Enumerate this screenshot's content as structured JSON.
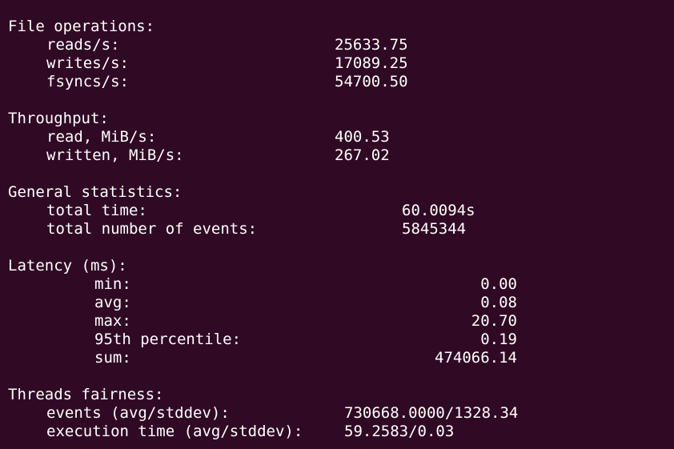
{
  "file_operations": {
    "title": "File operations:",
    "reads_label": "reads/s:",
    "reads_value": "25633.75",
    "writes_label": "writes/s:",
    "writes_value": "17089.25",
    "fsyncs_label": "fsyncs/s:",
    "fsyncs_value": "54700.50"
  },
  "throughput": {
    "title": "Throughput:",
    "read_label": "read, MiB/s:",
    "read_value": "400.53",
    "written_label": "written, MiB/s:",
    "written_value": "267.02"
  },
  "general_statistics": {
    "title": "General statistics:",
    "total_time_label": "total time:",
    "total_time_value": "60.0094s",
    "total_events_label": "total number of events:",
    "total_events_value": "5845344"
  },
  "latency": {
    "title": "Latency (ms):",
    "min_label": "min:",
    "min_value": "0.00",
    "avg_label": "avg:",
    "avg_value": "0.08",
    "max_label": "max:",
    "max_value": "20.70",
    "p95_label": "95th percentile:",
    "p95_value": "0.19",
    "sum_label": "sum:",
    "sum_value": "474066.14"
  },
  "threads_fairness": {
    "title": "Threads fairness:",
    "events_label": "events (avg/stddev):",
    "events_value": "730668.0000/1328.34",
    "exec_time_label": "execution time (avg/stddev):",
    "exec_time_value": "59.2583/0.03"
  }
}
